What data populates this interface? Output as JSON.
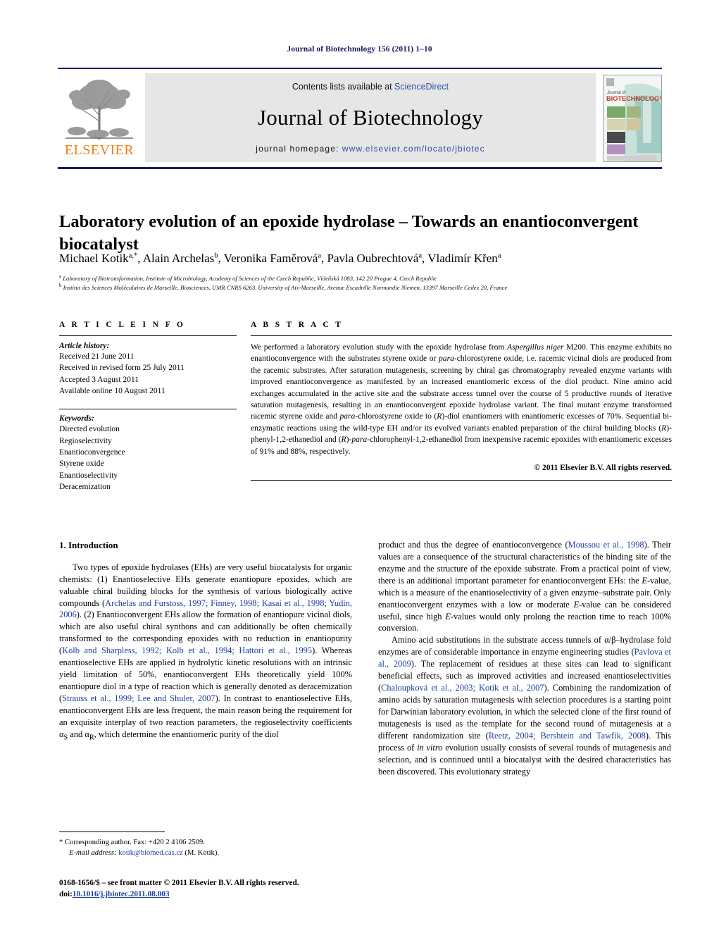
{
  "running_head": "Journal of Biotechnology 156 (2011) 1–10",
  "masthead": {
    "publisher_wordmark": "ELSEVIER",
    "contents_prefix": "Contents lists available at ",
    "contents_link": "ScienceDirect",
    "journal_title": "Journal of Biotechnology",
    "homepage_prefix": "journal homepage: ",
    "homepage_url": "www.elsevier.com/locate/jbiotec",
    "cover_line1": "Journal of",
    "cover_line2": "BIOTECHNOLOGY",
    "accent_orange": "#f07c1a",
    "accent_blue": "#2a4fa2",
    "rule_color": "#1b2060"
  },
  "article": {
    "title": "Laboratory evolution of an epoxide hydrolase – Towards an enantioconvergent biocatalyst",
    "authors_html": "Michael Kotik<sup>a,*</sup>, Alain Archelas<sup>b</sup>, Veronika Faměrová<sup>a</sup>, Pavla Oubrechtová<sup>a</sup>, Vladimír Křen<sup>a</sup>",
    "affiliation_a": "Laboratory of Biotransformation, Institute of Microbiology, Academy of Sciences of the Czech Republic, Vídeňská 1083, 142 20 Prague 4, Czech Republic",
    "affiliation_b": "Institut des Sciences Moléculaires de Marseille, Biosciences, UMR CNRS 6263, University of Aix-Marseille, Avenue Escadrille Normandie Niemen, 13397 Marseille Cedex 20, France"
  },
  "article_info": {
    "heading": "A R T I C L E    I N F O",
    "history_label": "Article history:",
    "history": [
      "Received 21 June 2011",
      "Received in revised form 25 July 2011",
      "Accepted 3 August 2011",
      "Available online 10 August 2011"
    ],
    "keywords_label": "Keywords:",
    "keywords": [
      "Directed evolution",
      "Regioselectivity",
      "Enantioconvergence",
      "Styrene oxide",
      "Enantioselectivity",
      "Deracemization"
    ]
  },
  "abstract": {
    "heading": "A B S T R A C T",
    "text_html": "We performed a laboratory evolution study with the epoxide hydrolase from <i>Aspergillus niger</i> M200. This enzyme exhibits no enantioconvergence with the substrates styrene oxide or <i>para</i>-chlorostyrene oxide, i.e. racemic vicinal diols are produced from the racemic substrates. After saturation mutagenesis, screening by chiral gas chromatography revealed enzyme variants with improved enantioconvergence as manifested by an increased enantiomeric excess of the diol product. Nine amino acid exchanges accumulated in the active site and the substrate access tunnel over the course of 5 productive rounds of iterative saturation mutagenesis, resulting in an enantioconvergent epoxide hydrolase variant. The final mutant enzyme transformed racemic styrene oxide and <i>para</i>-chlorostyrene oxide to (<i>R</i>)-diol enantiomers with enantiomeric excesses of 70%. Sequential bi-enzymatic reactions using the wild-type EH and/or its evolved variants enabled preparation of the chiral building blocks (<i>R</i>)-phenyl-1,2-ethanediol and (<i>R</i>)-<i>para</i>-chlorophenyl-1,2-ethanediol from inexpensive racemic epoxides with enantiomeric excesses of 91% and 88%, respectively.",
    "copyright": "© 2011 Elsevier B.V. All rights reserved."
  },
  "body": {
    "section_heading": "1.  Introduction",
    "left_paragraph_html": "Two types of epoxide hydrolases (EHs) are very useful biocatalysts for organic chemists: (1) Enantioselective EHs generate enantiopure epoxides, which are valuable chiral building blocks for the synthesis of various biologically active compounds (<span class=\"ref\">Archelas and Furstoss, 1997; Finney, 1998; Kasai et al., 1998; Yudin, 2006</span>). (2) Enantioconvergent EHs allow the formation of enantiopure vicinal diols, which are also useful chiral synthons and can additionally be often chemically transformed to the corresponding epoxides with no reduction in enantiopurity (<span class=\"ref\">Kolb and Sharpless, 1992; Kolb et al., 1994; Hattori et al., 1995</span>). Whereas enantioselective EHs are applied in hydrolytic kinetic resolutions with an intrinsic yield limitation of 50%, enantioconvergent EHs theoretically yield 100% enantiopure diol in a type of reaction which is generally denoted as deracemization (<span class=\"ref\">Strauss et al., 1999; Lee and Shuler, 2007</span>). In contrast to enantioselective EHs, enantioconvergent EHs are less frequent, the main reason being the requirement for an exquisite interplay of two reaction parameters, the regioselectivity coefficients α<sub>S</sub> and α<sub>R</sub>, which determine the enantiomeric purity of the diol",
    "right_paragraph_1_html": "product and thus the degree of enantioconvergence (<span class=\"ref\">Moussou et al., 1998</span>). Their values are a consequence of the structural characteristics of the binding site of the enzyme and the structure of the epoxide substrate. From a practical point of view, there is an additional important parameter for enantioconvergent EHs: the <i>E</i>-value, which is a measure of the enantioselectivity of a given enzyme–substrate pair. Only enantioconvergent enzymes with a low or moderate <i>E</i>-value can be considered useful, since high <i>E</i>-values would only prolong the reaction time to reach 100% conversion.",
    "right_paragraph_2_html": "Amino acid substitutions in the substrate access tunnels of α/β–hydrolase fold enzymes are of considerable importance in enzyme engineering studies (<span class=\"ref\">Pavlova et al., 2009</span>). The replacement of residues at these sites can lead to significant beneficial effects, such as improved activities and increased enantioselectivities (<span class=\"ref\">Chaloupková et al., 2003; Kotik et al., 2007</span>). Combining the randomization of amino acids by saturation mutagenesis with selection procedures is a starting point for Darwinian laboratory evolution, in which the selected clone of the first round of mutagenesis is used as the template for the second round of mutagenesis at a different randomization site (<span class=\"ref\">Reetz, 2004; Bershtein and Tawfik, 2008</span>). This process of <i>in vitro</i> evolution usually consists of several rounds of mutagenesis and selection, and is continued until a biocatalyst with the desired characteristics has been discovered. This evolutionary strategy"
  },
  "footer": {
    "corresponding_note": "* Corresponding author. Fax: +420 2 4106 2509.",
    "email_label": "E-mail address:",
    "email": "kotik@biomed.cas.cz",
    "email_suffix": "(M. Kotik).",
    "front_matter": "0168-1656/$ – see front matter © 2011 Elsevier B.V. All rights reserved.",
    "doi_label": "doi:",
    "doi": "10.1016/j.jbiotec.2011.08.003"
  }
}
